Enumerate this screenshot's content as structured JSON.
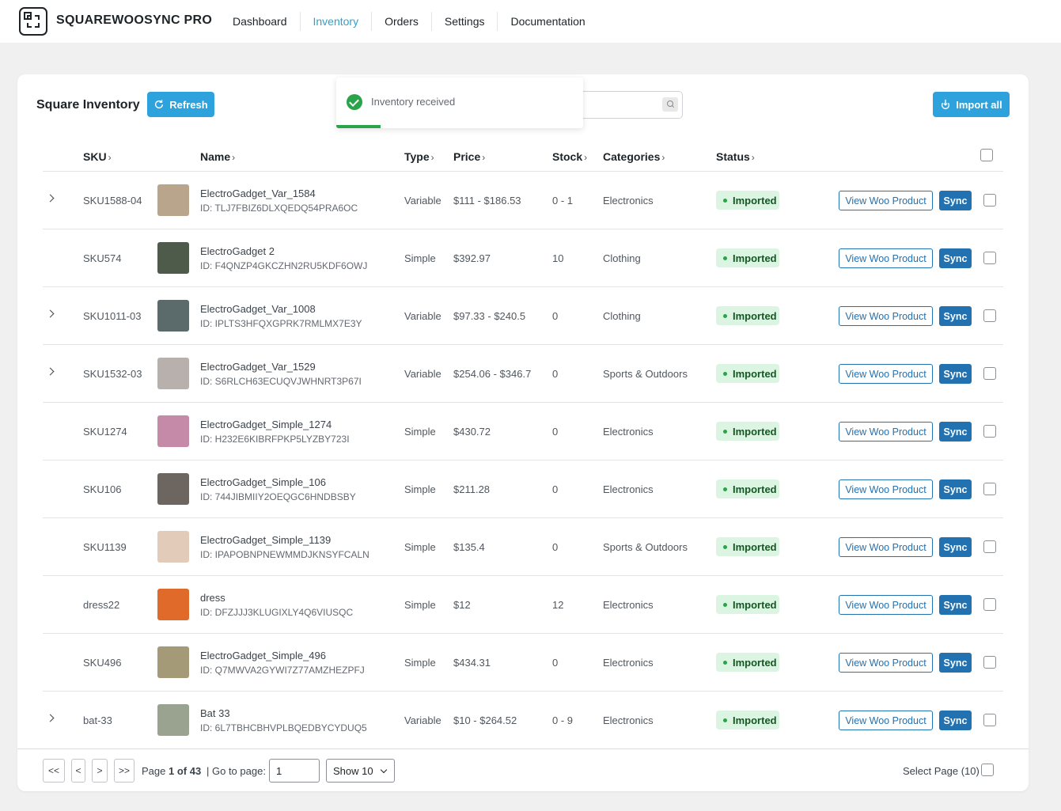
{
  "app": {
    "brand": "SQUAREWOOSYNC PRO",
    "nav": [
      "Dashboard",
      "Inventory",
      "Orders",
      "Settings",
      "Documentation"
    ],
    "active_nav": "Inventory"
  },
  "toast": {
    "message": "Inventory received",
    "progress": 0.18
  },
  "panel": {
    "title": "Square Inventory",
    "refresh_label": "Refresh",
    "import_all_label": "Import all",
    "search_value": ""
  },
  "table": {
    "headers": {
      "sku": "SKU",
      "name": "Name",
      "type": "Type",
      "price": "Price",
      "stock": "Stock",
      "categories": "Categories",
      "status": "Status"
    },
    "status_label": "Imported",
    "view_label": "View Woo Product",
    "sync_label": "Sync",
    "rows": [
      {
        "expandable": true,
        "sku": "SKU1588-04",
        "name": "ElectroGadget_Var_1584",
        "id": "ID: TLJ7FBIZ6DLXQEDQ54PRA6OC",
        "type": "Variable",
        "price": "$111 - $186.53",
        "stock": "0 - 1",
        "category": "Electronics",
        "thumb_color": "#b9a58c"
      },
      {
        "expandable": false,
        "sku": "SKU574",
        "name": "ElectroGadget 2",
        "id": "ID: F4QNZP4GKCZHN2RU5KDF6OWJ",
        "type": "Simple",
        "price": "$392.97",
        "stock": "10",
        "category": "Clothing",
        "thumb_color": "#4e5a4a"
      },
      {
        "expandable": true,
        "sku": "SKU1011-03",
        "name": "ElectroGadget_Var_1008",
        "id": "ID: IPLTS3HFQXGPRK7RMLMX7E3Y",
        "type": "Variable",
        "price": "$97.33 - $240.5",
        "stock": "0",
        "category": "Clothing",
        "thumb_color": "#5b6b6b"
      },
      {
        "expandable": true,
        "sku": "SKU1532-03",
        "name": "ElectroGadget_Var_1529",
        "id": "ID: S6RLCH63ECUQVJWHNRT3P67I",
        "type": "Variable",
        "price": "$254.06 - $346.7",
        "stock": "0",
        "category": "Sports & Outdoors",
        "thumb_color": "#b8b0ac"
      },
      {
        "expandable": false,
        "sku": "SKU1274",
        "name": "ElectroGadget_Simple_1274",
        "id": "ID: H232E6KIBRFPKP5LYZBY723I",
        "type": "Simple",
        "price": "$430.72",
        "stock": "0",
        "category": "Electronics",
        "thumb_color": "#c48aa8"
      },
      {
        "expandable": false,
        "sku": "SKU106",
        "name": "ElectroGadget_Simple_106",
        "id": "ID: 744JIBMIIY2OEQGC6HNDBSBY",
        "type": "Simple",
        "price": "$211.28",
        "stock": "0",
        "category": "Electronics",
        "thumb_color": "#6d6560"
      },
      {
        "expandable": false,
        "sku": "SKU1139",
        "name": "ElectroGadget_Simple_1139",
        "id": "ID: IPAPOBNPNEWMMDJKNSYFCALN",
        "type": "Simple",
        "price": "$135.4",
        "stock": "0",
        "category": "Sports & Outdoors",
        "thumb_color": "#e2cbb8"
      },
      {
        "expandable": false,
        "sku": "dress22",
        "name": "dress",
        "id": "ID: DFZJJJ3KLUGIXLY4Q6VIUSQC",
        "type": "Simple",
        "price": "$12",
        "stock": "12",
        "category": "Electronics",
        "thumb_color": "#e06a2a"
      },
      {
        "expandable": false,
        "sku": "SKU496",
        "name": "ElectroGadget_Simple_496",
        "id": "ID: Q7MWVA2GYWI7Z77AMZHEZPFJ",
        "type": "Simple",
        "price": "$434.31",
        "stock": "0",
        "category": "Electronics",
        "thumb_color": "#a49a78"
      },
      {
        "expandable": true,
        "sku": "bat-33",
        "name": "Bat 33",
        "id": "ID: 6L7TBHCBHVPLBQEDBYCYDUQ5",
        "type": "Variable",
        "price": "$10 - $264.52",
        "stock": "0 - 9",
        "category": "Electronics",
        "thumb_color": "#9aa290"
      }
    ]
  },
  "pagination": {
    "first": "<<",
    "prev": "<",
    "next": ">",
    "last": ">>",
    "page_prefix": "Page",
    "page_current": "1 of 43",
    "goto_label": "| Go to page:",
    "goto_value": "1",
    "show_value": "Show 10",
    "select_page_label": "Select Page (10)"
  },
  "colors": {
    "accent": "#2ea2dc",
    "sync": "#2271b1",
    "imported_bg": "#dcf5e2",
    "imported_dot": "#2aa44a"
  }
}
